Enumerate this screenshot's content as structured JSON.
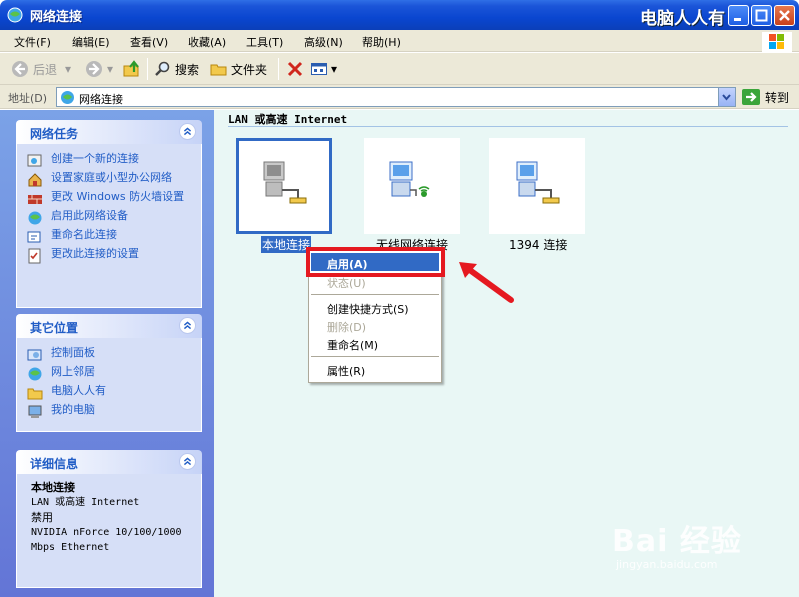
{
  "window": {
    "title": "网络连接",
    "brand": "电脑人人有"
  },
  "menu": [
    "文件(F)",
    "编辑(E)",
    "查看(V)",
    "收藏(A)",
    "工具(T)",
    "高级(N)",
    "帮助(H)"
  ],
  "toolbar": {
    "back": "后退",
    "search": "搜索",
    "folders": "文件夹"
  },
  "address": {
    "label": "地址(D)",
    "value": "网络连接",
    "go": "转到"
  },
  "network_tasks": {
    "title": "网络任务",
    "items": [
      "创建一个新的连接",
      "设置家庭或小型办公网络",
      "更改 Windows 防火墙设置",
      "启用此网络设备",
      "重命名此连接",
      "更改此连接的设置"
    ]
  },
  "other_places": {
    "title": "其它位置",
    "items": [
      "控制面板",
      "网上邻居",
      "电脑人人有",
      "我的电脑"
    ]
  },
  "details": {
    "title": "详细信息",
    "name": "本地连接",
    "type": "LAN 或高速 Internet",
    "status": "禁用",
    "device": "NVIDIA nForce 10/100/1000 Mbps Ethernet"
  },
  "group_header": "LAN 或高速 Internet",
  "connections": [
    {
      "label": "本地连接",
      "icon": "lan-computer-icon",
      "selected": true
    },
    {
      "label": "无线网络连接",
      "icon": "wireless-computer-icon",
      "selected": false
    },
    {
      "label": "1394 连接",
      "icon": "lan-computer-icon",
      "selected": false
    }
  ],
  "context_menu": {
    "enable": "启用(A)",
    "status": "状态(U)",
    "create_shortcut": "创建快捷方式(S)",
    "delete": "删除(D)",
    "rename": "重命名(M)",
    "properties": "属性(R)"
  },
  "watermark": {
    "logo": "Bai 经验",
    "url": "jingyan.baidu.com"
  },
  "colors": {
    "title_bar": "#0a46d0",
    "highlight": "#316ac5",
    "annotation": "#e51920",
    "task_text": "#215dc6"
  }
}
